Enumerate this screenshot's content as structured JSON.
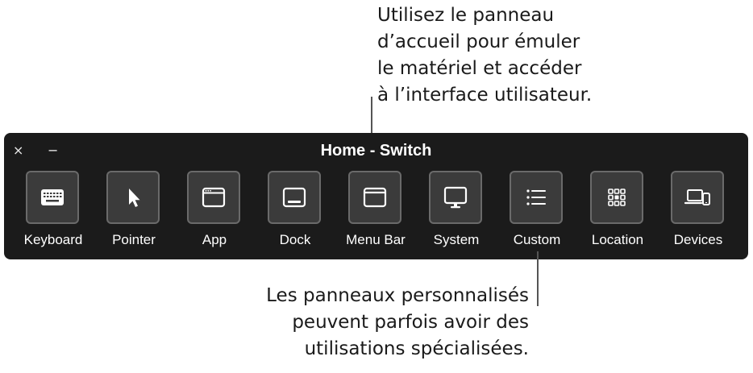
{
  "callouts": {
    "top": [
      "Utilisez le panneau",
      "d’accueil pour émuler",
      "le matériel et accéder",
      "à l’interface utilisateur."
    ],
    "bottom": [
      "Les panneaux personnalisés",
      "peuvent parfois avoir des",
      "utilisations spécialisées."
    ]
  },
  "panel": {
    "title": "Home - Switch",
    "close_glyph": "×",
    "minimize_glyph": "−",
    "items": [
      {
        "label": "Keyboard",
        "icon": "keyboard-icon"
      },
      {
        "label": "Pointer",
        "icon": "pointer-arrow-icon"
      },
      {
        "label": "App",
        "icon": "app-window-icon"
      },
      {
        "label": "Dock",
        "icon": "dock-icon"
      },
      {
        "label": "Menu Bar",
        "icon": "menu-bar-icon"
      },
      {
        "label": "System",
        "icon": "display-icon"
      },
      {
        "label": "Custom",
        "icon": "list-icon"
      },
      {
        "label": "Location",
        "icon": "grid-icon"
      },
      {
        "label": "Devices",
        "icon": "laptop-phone-icon"
      }
    ]
  },
  "colors": {
    "panel_background": "#1b1b1b",
    "tile_background": "#3b3b3b",
    "tile_border": "#6a6a6a",
    "text": "#ffffff"
  }
}
